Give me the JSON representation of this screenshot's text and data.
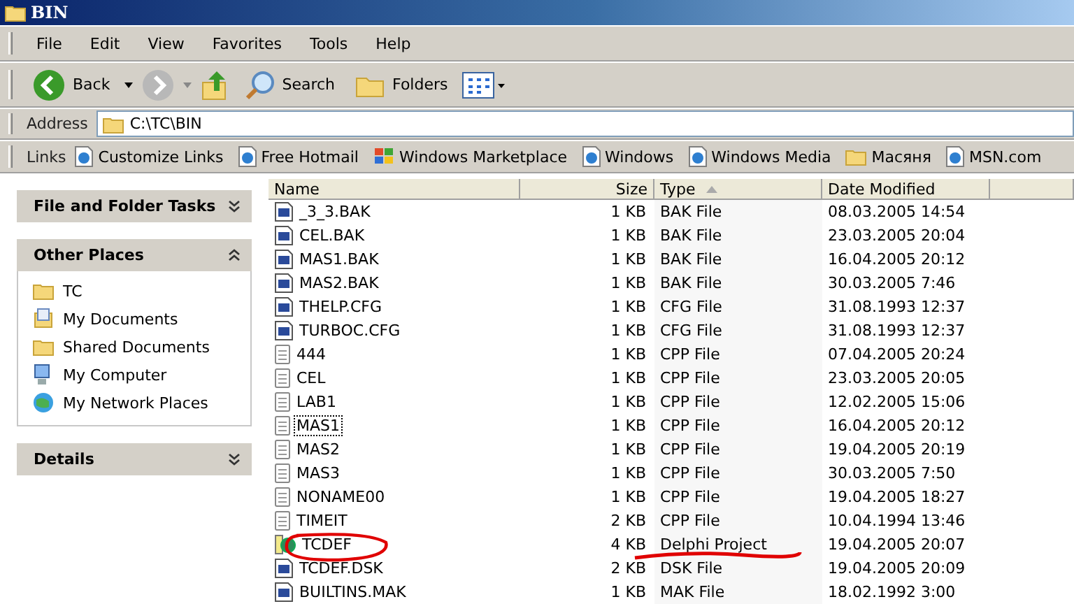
{
  "window": {
    "title": "BIN"
  },
  "menu": [
    "File",
    "Edit",
    "View",
    "Favorites",
    "Tools",
    "Help"
  ],
  "toolbar": {
    "back": "Back",
    "search": "Search",
    "folders": "Folders"
  },
  "address": {
    "label": "Address",
    "value": "C:\\TC\\BIN"
  },
  "links": {
    "label": "Links",
    "items": [
      {
        "text": "Customize Links",
        "kind": "web"
      },
      {
        "text": "Free Hotmail",
        "kind": "web"
      },
      {
        "text": "Windows Marketplace",
        "kind": "flag"
      },
      {
        "text": "Windows",
        "kind": "web"
      },
      {
        "text": "Windows Media",
        "kind": "web"
      },
      {
        "text": "Масяня",
        "kind": "folder"
      },
      {
        "text": "MSN.com",
        "kind": "web"
      }
    ]
  },
  "sidebar": [
    {
      "title": "File and Folder Tasks",
      "expanded": false
    },
    {
      "title": "Other Places",
      "expanded": true,
      "items": [
        {
          "text": "TC",
          "kind": "folder"
        },
        {
          "text": "My Documents",
          "kind": "documents"
        },
        {
          "text": "Shared Documents",
          "kind": "folder"
        },
        {
          "text": "My Computer",
          "kind": "computer"
        },
        {
          "text": "My Network Places",
          "kind": "network"
        }
      ]
    },
    {
      "title": "Details",
      "expanded": false
    }
  ],
  "table": {
    "columns": [
      {
        "label": "Name",
        "sorted": false
      },
      {
        "label": "Size",
        "sorted": false
      },
      {
        "label": "Type",
        "sorted": true
      },
      {
        "label": "Date Modified",
        "sorted": false
      }
    ],
    "rows": [
      {
        "name": "_3_3.BAK",
        "size": "1 KB",
        "type": "BAK File",
        "date": "08.03.2005 14:54",
        "kind": "app",
        "focused": false
      },
      {
        "name": "CEL.BAK",
        "size": "1 KB",
        "type": "BAK File",
        "date": "23.03.2005 20:04",
        "kind": "app",
        "focused": false
      },
      {
        "name": "MAS1.BAK",
        "size": "1 KB",
        "type": "BAK File",
        "date": "16.04.2005 20:12",
        "kind": "app",
        "focused": false
      },
      {
        "name": "MAS2.BAK",
        "size": "1 KB",
        "type": "BAK File",
        "date": "30.03.2005 7:46",
        "kind": "app",
        "focused": false
      },
      {
        "name": "THELP.CFG",
        "size": "1 KB",
        "type": "CFG File",
        "date": "31.08.1993 12:37",
        "kind": "app",
        "focused": false
      },
      {
        "name": "TURBOC.CFG",
        "size": "1 KB",
        "type": "CFG File",
        "date": "31.08.1993 12:37",
        "kind": "app",
        "focused": false
      },
      {
        "name": "444",
        "size": "1 KB",
        "type": "CPP File",
        "date": "07.04.2005 20:24",
        "kind": "text",
        "focused": false
      },
      {
        "name": "CEL",
        "size": "1 KB",
        "type": "CPP File",
        "date": "23.03.2005 20:05",
        "kind": "text",
        "focused": false
      },
      {
        "name": "LAB1",
        "size": "1 KB",
        "type": "CPP File",
        "date": "12.02.2005 15:06",
        "kind": "text",
        "focused": false
      },
      {
        "name": "MAS1",
        "size": "1 KB",
        "type": "CPP File",
        "date": "16.04.2005 20:12",
        "kind": "text",
        "focused": true
      },
      {
        "name": "MAS2",
        "size": "1 KB",
        "type": "CPP File",
        "date": "19.04.2005 20:19",
        "kind": "text",
        "focused": false
      },
      {
        "name": "MAS3",
        "size": "1 KB",
        "type": "CPP File",
        "date": "30.03.2005 7:50",
        "kind": "text",
        "focused": false
      },
      {
        "name": "NONAME00",
        "size": "1 KB",
        "type": "CPP File",
        "date": "19.04.2005 18:27",
        "kind": "text",
        "focused": false
      },
      {
        "name": "TIMEIT",
        "size": "2 KB",
        "type": "CPP File",
        "date": "10.04.1994 13:46",
        "kind": "text",
        "focused": false
      },
      {
        "name": "TCDEF",
        "size": "4 KB",
        "type": "Delphi Project",
        "date": "19.04.2005 20:07",
        "kind": "delphi",
        "focused": false
      },
      {
        "name": "TCDEF.DSK",
        "size": "2 KB",
        "type": "DSK File",
        "date": "19.04.2005 20:09",
        "kind": "app",
        "focused": false
      },
      {
        "name": "BUILTINS.MAK",
        "size": "1 KB",
        "type": "MAK File",
        "date": "18.02.1992 3:00",
        "kind": "app",
        "focused": false
      }
    ]
  }
}
